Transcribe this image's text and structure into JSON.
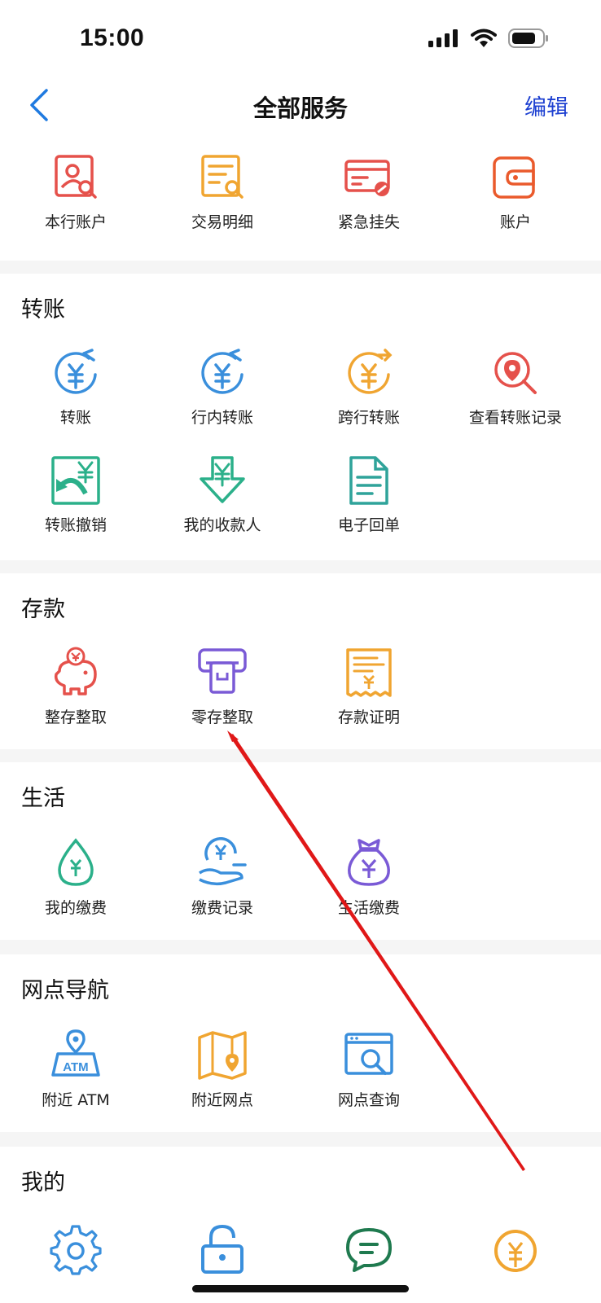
{
  "status": {
    "time": "15:00"
  },
  "nav": {
    "title": "全部服务",
    "edit_label": "编辑"
  },
  "top_services": [
    {
      "label": "本行账户",
      "icon": "account-search-icon"
    },
    {
      "label": "交易明细",
      "icon": "transaction-detail-icon"
    },
    {
      "label": "紧急挂失",
      "icon": "card-loss-icon"
    },
    {
      "label": "账户",
      "icon": "wallet-icon"
    }
  ],
  "sections": {
    "transfer": {
      "title": "转账",
      "items": [
        {
          "label": "转账",
          "icon": "transfer-icon"
        },
        {
          "label": "行内转账",
          "icon": "internal-transfer-icon"
        },
        {
          "label": "跨行转账",
          "icon": "interbank-transfer-icon"
        },
        {
          "label": "查看转账记录",
          "icon": "transfer-record-icon"
        },
        {
          "label": "转账撤销",
          "icon": "transfer-revoke-icon"
        },
        {
          "label": "我的收款人",
          "icon": "payee-icon"
        },
        {
          "label": "电子回单",
          "icon": "e-receipt-icon"
        }
      ]
    },
    "deposit": {
      "title": "存款",
      "items": [
        {
          "label": "整存整取",
          "icon": "piggy-bank-icon"
        },
        {
          "label": "零存整取",
          "icon": "atm-slot-icon"
        },
        {
          "label": "存款证明",
          "icon": "deposit-certificate-icon"
        }
      ]
    },
    "life": {
      "title": "生活",
      "items": [
        {
          "label": "我的缴费",
          "icon": "water-drop-icon"
        },
        {
          "label": "缴费记录",
          "icon": "payment-hand-icon"
        },
        {
          "label": "生活缴费",
          "icon": "money-bag-icon"
        }
      ]
    },
    "outlet": {
      "title": "网点导航",
      "items": [
        {
          "label": "附近 ATM",
          "icon": "atm-location-icon"
        },
        {
          "label": "附近网点",
          "icon": "map-location-icon"
        },
        {
          "label": "网点查询",
          "icon": "outlet-search-icon"
        }
      ]
    },
    "mine": {
      "title": "我的",
      "items": [
        {
          "label": "",
          "icon": "gear-icon"
        },
        {
          "label": "",
          "icon": "lock-icon"
        },
        {
          "label": "",
          "icon": "chat-icon"
        },
        {
          "label": "",
          "icon": "coin-icon"
        }
      ]
    }
  },
  "colors": {
    "accent_blue": "#3a8fdc",
    "nav_blue": "#1c3fd1",
    "red": "#e5514b",
    "orange": "#f0a531",
    "green": "#2bb08a",
    "teal": "#2fa39a",
    "purple": "#7a5ad6",
    "annotation": "#e01818"
  }
}
